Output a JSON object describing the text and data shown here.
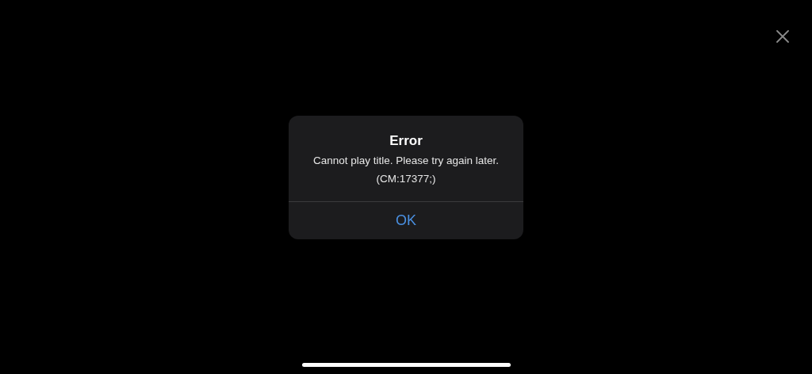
{
  "dialog": {
    "title": "Error",
    "message_lines": [
      "Cannot play title. Please try again later.",
      "(CM:17377;)"
    ],
    "buttons": [
      {
        "label": "OK"
      }
    ]
  }
}
